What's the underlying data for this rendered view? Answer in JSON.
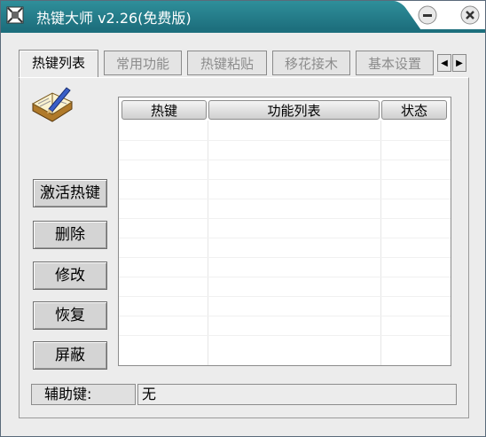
{
  "window": {
    "title": "热键大师 v2.26(免费版)"
  },
  "tabs": [
    {
      "label": "热键列表",
      "active": true
    },
    {
      "label": "常用功能",
      "active": false
    },
    {
      "label": "热键粘贴",
      "active": false
    },
    {
      "label": "移花接木",
      "active": false
    },
    {
      "label": "基本设置",
      "active": false
    }
  ],
  "tab_scroll": {
    "left": "◀",
    "right": "▶"
  },
  "buttons": {
    "activate": "激活热键",
    "delete": "删除",
    "modify": "修改",
    "restore": "恢复",
    "block": "屏蔽"
  },
  "table": {
    "headers": [
      "热键",
      "功能列表",
      "状态"
    ],
    "rows": []
  },
  "status": {
    "label": "辅助键:",
    "value": "无"
  },
  "colors": {
    "titlebar": "#1d6f7d",
    "panel_bg": "#ececec"
  },
  "icons": [
    "app-icon",
    "minimize-icon",
    "close-icon",
    "book-pen-icon"
  ]
}
